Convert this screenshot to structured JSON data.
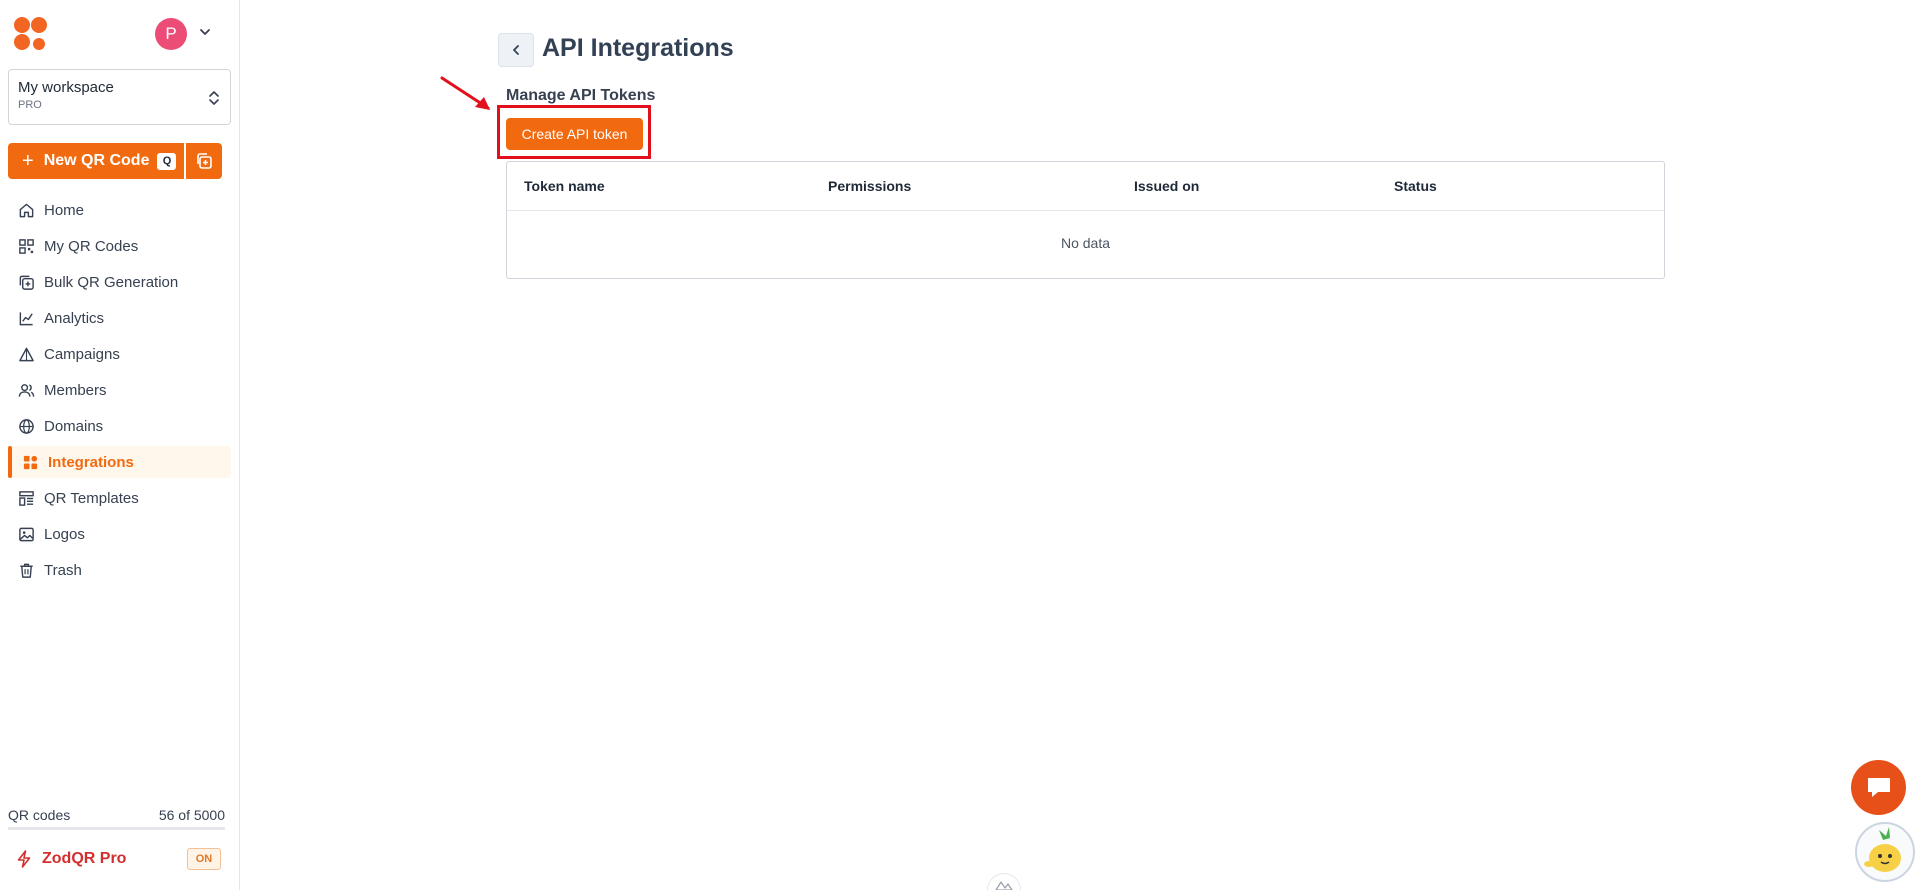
{
  "sidebar": {
    "avatar_letter": "P",
    "workspace": {
      "name": "My workspace",
      "plan": "PRO"
    },
    "new_qr": {
      "label": "New QR Code",
      "shortcut": "Q"
    },
    "nav": [
      {
        "label": "Home",
        "icon": "home-icon"
      },
      {
        "label": "My QR Codes",
        "icon": "qr-grid-icon"
      },
      {
        "label": "Bulk QR Generation",
        "icon": "bulk-copy-icon"
      },
      {
        "label": "Analytics",
        "icon": "analytics-icon"
      },
      {
        "label": "Campaigns",
        "icon": "campaign-icon"
      },
      {
        "label": "Members",
        "icon": "members-icon"
      },
      {
        "label": "Domains",
        "icon": "globe-icon"
      },
      {
        "label": "Integrations",
        "icon": "integrations-icon",
        "active": true
      },
      {
        "label": "QR Templates",
        "icon": "templates-icon"
      },
      {
        "label": "Logos",
        "icon": "image-icon"
      },
      {
        "label": "Trash",
        "icon": "trash-icon"
      }
    ],
    "qr_count": {
      "label": "QR codes",
      "value": "56 of 5000"
    },
    "pro": {
      "label": "ZodQR Pro",
      "badge": "ON"
    }
  },
  "main": {
    "title": "API Integrations",
    "section_title": "Manage API Tokens",
    "create_button": "Create API token",
    "table": {
      "columns": [
        "Token name",
        "Permissions",
        "Issued on",
        "Status"
      ],
      "empty_text": "No data"
    }
  },
  "colors": {
    "accent": "#f26a10",
    "highlight": "#e0111d",
    "pro": "#d32f2f"
  }
}
